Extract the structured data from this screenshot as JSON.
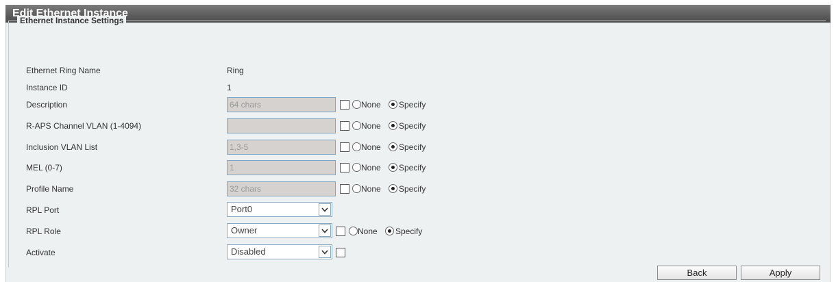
{
  "title": "Edit Ethernet Instance",
  "section_title": "Ethernet Instance Settings",
  "radio_none": "None",
  "radio_specify": "Specify",
  "fields": {
    "ring_name": {
      "label": "Ethernet Ring Name",
      "value": "Ring"
    },
    "instance_id": {
      "label": "Instance ID",
      "value": "1"
    },
    "description": {
      "label": "Description",
      "value": "64 chars",
      "mode": "Specify"
    },
    "raps_vlan": {
      "label": "R-APS Channel VLAN (1-4094)",
      "value": "",
      "mode": "Specify"
    },
    "inclusion_vlan": {
      "label": "Inclusion VLAN List",
      "value": "1,3-5",
      "mode": "Specify"
    },
    "mel": {
      "label": "MEL (0-7)",
      "value": "1",
      "mode": "Specify"
    },
    "profile_name": {
      "label": "Profile Name",
      "value": "32 chars",
      "mode": "Specify"
    },
    "rpl_port": {
      "label": "RPL Port",
      "value": "Port0"
    },
    "rpl_role": {
      "label": "RPL Role",
      "value": "Owner",
      "mode": "Specify"
    },
    "activate": {
      "label": "Activate",
      "value": "Disabled"
    }
  },
  "buttons": {
    "back": "Back",
    "apply": "Apply"
  }
}
